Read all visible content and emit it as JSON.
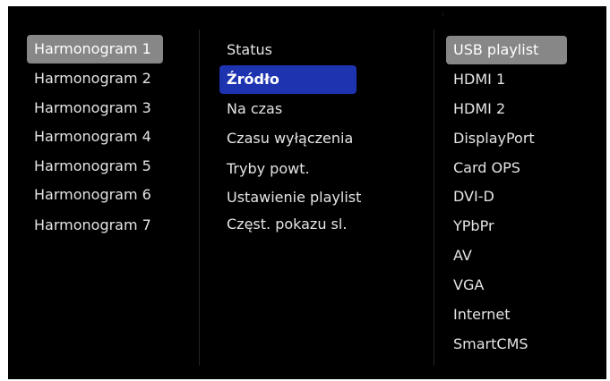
{
  "menu": {
    "schedules": [
      {
        "label": "Harmonogram 1",
        "highlight": "gray"
      },
      {
        "label": "Harmonogram 2"
      },
      {
        "label": "Harmonogram 3"
      },
      {
        "label": "Harmonogram 4"
      },
      {
        "label": "Harmonogram 5"
      },
      {
        "label": "Harmonogram 6"
      },
      {
        "label": "Harmonogram 7"
      }
    ],
    "settings": [
      {
        "label": "Status"
      },
      {
        "label": "Źródło",
        "highlight": "blue"
      },
      {
        "label": "Na czas"
      },
      {
        "label": "Czasu wyłączenia"
      },
      {
        "label": "Tryby powt."
      },
      {
        "label": "Ustawienie playlist"
      },
      {
        "label": "Częst. pokazu sl."
      }
    ],
    "sources": [
      {
        "label": "USB playlist",
        "highlight": "gray"
      },
      {
        "label": "HDMI 1"
      },
      {
        "label": "HDMI 2"
      },
      {
        "label": "DisplayPort"
      },
      {
        "label": "Card OPS"
      },
      {
        "label": "DVI-D"
      },
      {
        "label": "YPbPr"
      },
      {
        "label": "AV"
      },
      {
        "label": "VGA"
      },
      {
        "label": "Internet"
      },
      {
        "label": "SmartCMS"
      }
    ]
  },
  "colors": {
    "background": "#000000",
    "text": "#e4e4e4",
    "highlight_gray": "#878787",
    "highlight_blue": "#1d33b0"
  }
}
